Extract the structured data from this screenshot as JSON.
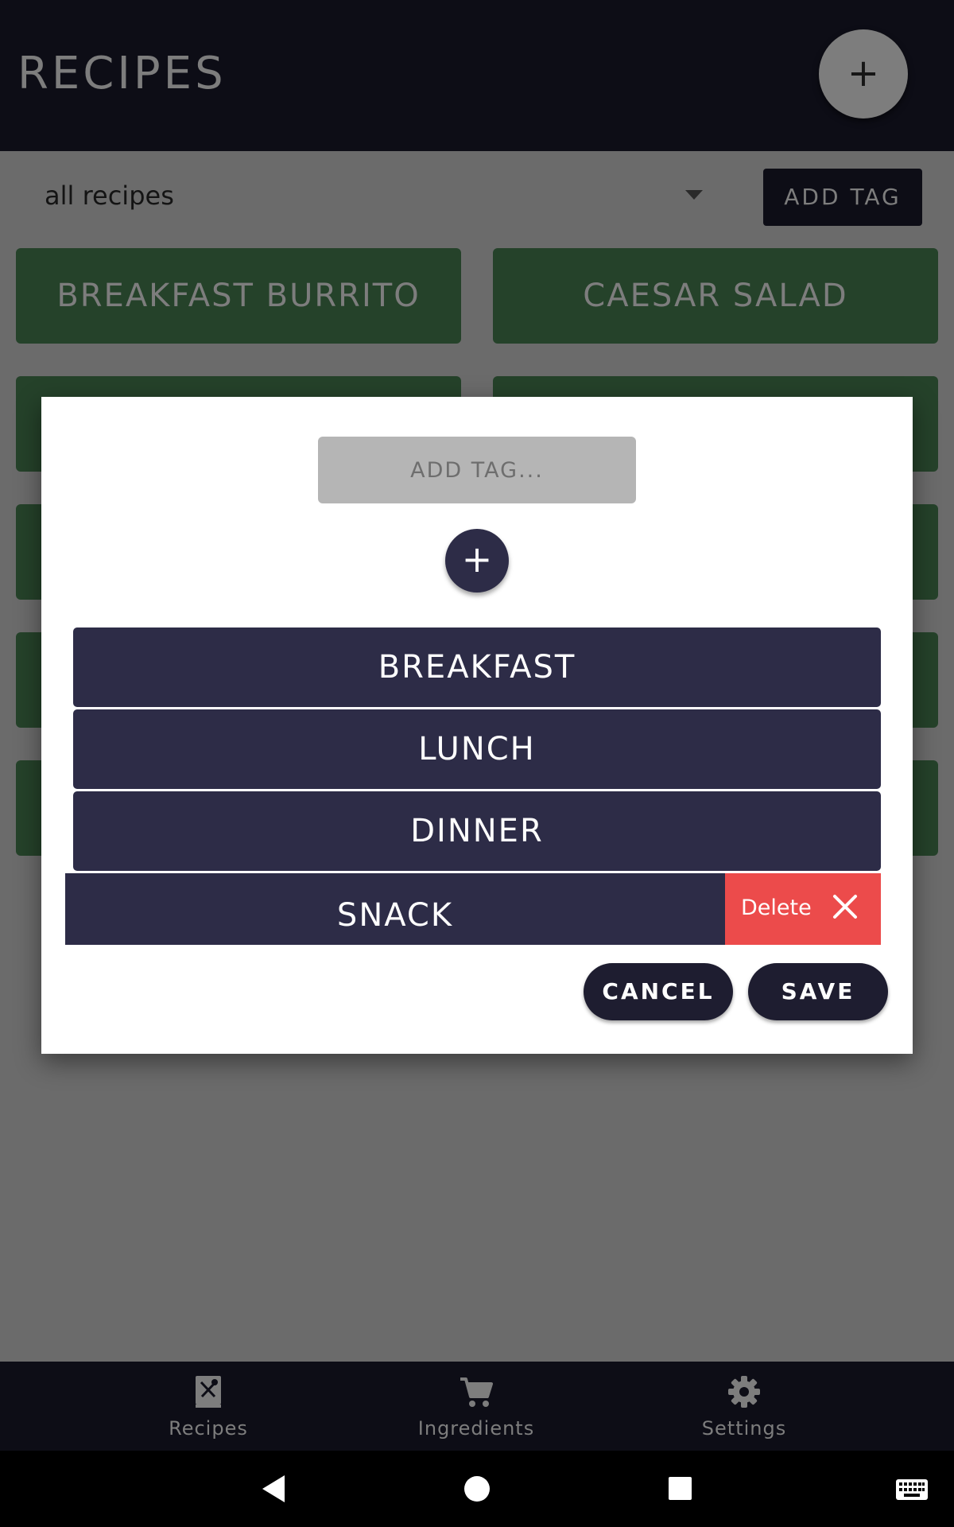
{
  "header": {
    "title": "RECIPES",
    "fab_label": "+"
  },
  "filter": {
    "selected": "all recipes",
    "add_tag_button": "ADD TAG"
  },
  "recipes": [
    {
      "name": "BREAKFAST BURRITO"
    },
    {
      "name": "CAESAR SALAD"
    }
  ],
  "dialog": {
    "input_placeholder": "ADD TAG...",
    "add_button_label": "+",
    "tags": [
      {
        "label": "BREAKFAST"
      },
      {
        "label": "LUNCH"
      },
      {
        "label": "DINNER"
      },
      {
        "label": "SNACK"
      }
    ],
    "delete_action_label": "Delete",
    "cancel_label": "CANCEL",
    "save_label": "SAVE"
  },
  "bottom_nav": [
    {
      "label": "Recipes",
      "icon": "recipe-book-icon"
    },
    {
      "label": "Ingredients",
      "icon": "cart-icon"
    },
    {
      "label": "Settings",
      "icon": "gear-icon"
    }
  ],
  "colors": {
    "header_bg": "#0d0d16",
    "card_green": "#25422a",
    "tag_navy": "#2d2c47",
    "delete_red": "#ec4b4b",
    "scrim": "#6b6b6b"
  }
}
